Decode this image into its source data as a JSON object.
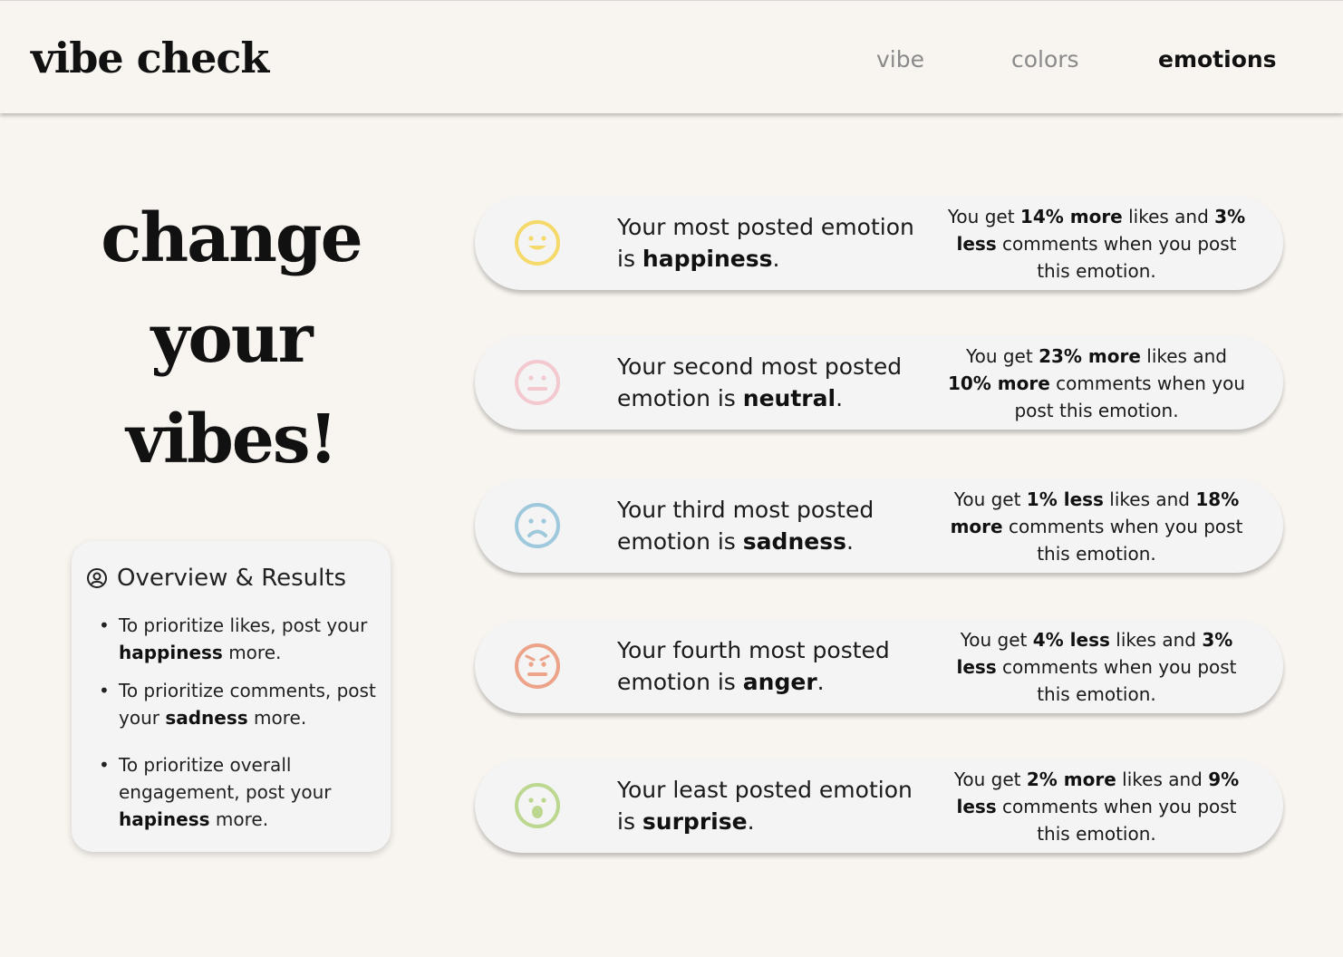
{
  "header": {
    "logo": "vibe check",
    "nav": [
      {
        "label": "vibe",
        "active": false
      },
      {
        "label": "colors",
        "active": false
      },
      {
        "label": "emotions",
        "active": true
      }
    ]
  },
  "hero": {
    "lines": [
      "change",
      "your",
      "vibes!"
    ]
  },
  "overview": {
    "icon": "user-circle-icon",
    "title": "Overview & Results",
    "items": [
      {
        "pre": "To prioritize likes, post your ",
        "bold": "happiness",
        "post": " more."
      },
      {
        "pre": "To prioritize comments, post your ",
        "bold": "sadness",
        "post": " more."
      },
      {
        "pre": "To prioritize overall engagement, post your ",
        "bold": "hapiness",
        "post": " more."
      }
    ]
  },
  "emotions": [
    {
      "icon": "happy-face-icon",
      "color": "#f5d96b",
      "pre": "Your most posted emotion is ",
      "emotion": "happiness",
      "end": ".",
      "s1": "You get ",
      "s2": "14% more",
      "s3": " likes and ",
      "s4": "3% less",
      "s5": " comments when you post this emotion."
    },
    {
      "icon": "neutral-face-icon",
      "color": "#f3c8cf",
      "pre": "Your second most posted emotion is ",
      "emotion": "neutral",
      "end": ".",
      "s1": "You get ",
      "s2": "23% more",
      "s3": " likes and ",
      "s4": "10% more",
      "s5": " comments when you post this emotion."
    },
    {
      "icon": "sad-face-icon",
      "color": "#9ec8dc",
      "pre": "Your third most posted emotion is ",
      "emotion": "sadness",
      "end": ".",
      "s1": "You get ",
      "s2": "1% less",
      "s3": " likes and ",
      "s4": "18% more",
      "s5": " comments when you post this emotion."
    },
    {
      "icon": "angry-face-icon",
      "color": "#eca389",
      "pre": "Your fourth most posted emotion is ",
      "emotion": "anger",
      "end": ".",
      "s1": "You get ",
      "s2": "4% less",
      "s3": " likes and ",
      "s4": "3% less",
      "s5": " comments when you post this emotion."
    },
    {
      "icon": "surprised-face-icon",
      "color": "#bcd78f",
      "pre": "Your least posted emotion is ",
      "emotion": "surprise",
      "end": ".",
      "s1": "You get ",
      "s2": "2% more",
      "s3": " likes and ",
      "s4": "9% less",
      "s5": " comments when you post this emotion."
    }
  ]
}
